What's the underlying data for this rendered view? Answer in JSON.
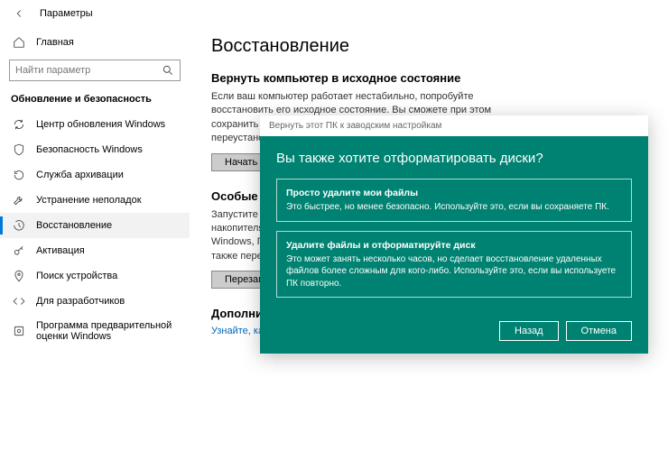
{
  "header": {
    "title": "Параметры"
  },
  "sidebar": {
    "home": "Главная",
    "search_placeholder": "Найти параметр",
    "category": "Обновление и безопасность",
    "items": [
      {
        "label": "Центр обновления Windows"
      },
      {
        "label": "Безопасность Windows"
      },
      {
        "label": "Служба архивации"
      },
      {
        "label": "Устранение неполадок"
      },
      {
        "label": "Восстановление"
      },
      {
        "label": "Активация"
      },
      {
        "label": "Поиск устройства"
      },
      {
        "label": "Для разработчиков"
      },
      {
        "label": "Программа предварительной оценки Windows"
      }
    ]
  },
  "main": {
    "title": "Восстановление",
    "reset": {
      "heading": "Вернуть компьютер в исходное состояние",
      "text": "Если ваш компьютер работает нестабильно, попробуйте восстановить его исходное состояние. Вы сможете при этом сохранить личные файлы или удалить их, а затем переустановить Windows.",
      "button": "Начать"
    },
    "advanced": {
      "heading": "Особые варианты загрузки",
      "text": "Запустите систему с устройства либо диска (например, USB-накопителя или DVD-диска), измените параметры загрузки Windows, ПО компьютера или восстановите Windows из образа, а также перезагрузите систему.",
      "button": "Перезагрузить сейчас"
    },
    "more": {
      "heading": "Дополнительные параметры восстановления",
      "link": "Узнайте, как начать заново с чистой установкой Windows"
    }
  },
  "dialog": {
    "bar": "Вернуть этот ПК к заводским настройкам",
    "title": "Вы также хотите отформатировать диски?",
    "opt1_title": "Просто удалите мои файлы",
    "opt1_text": "Это быстрее, но менее безопасно. Используйте это, если вы сохраняете ПК.",
    "opt2_title": "Удалите файлы и отформатируйте диск",
    "opt2_text": "Это может занять несколько часов, но сделает восстановление удаленных файлов более сложным для кого-либо. Используйте это, если вы используете ПК повторно.",
    "back": "Назад",
    "cancel": "Отмена"
  }
}
